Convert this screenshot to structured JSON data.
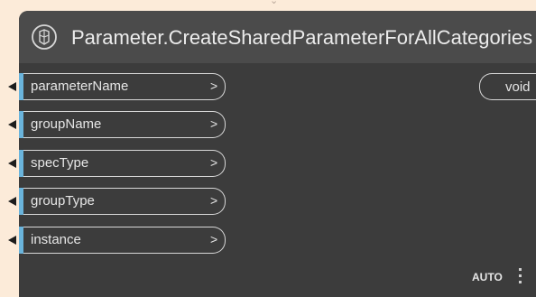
{
  "node": {
    "title": "Parameter.CreateSharedParameterForAllCategories",
    "icon": "revit-parameter-icon"
  },
  "inputs": [
    {
      "label": "parameterName",
      "arrow": ">"
    },
    {
      "label": "groupName",
      "arrow": ">"
    },
    {
      "label": "specType",
      "arrow": ">"
    },
    {
      "label": "groupType",
      "arrow": ">"
    },
    {
      "label": "instance",
      "arrow": ">"
    }
  ],
  "output": {
    "label": "void"
  },
  "footer": {
    "lacing": "AUTO"
  },
  "colors": {
    "background": "#fcebd9",
    "node_body": "#3c3c3c",
    "node_header": "#4b4b4b",
    "port_accent": "#6ab4dc",
    "text": "#e6e6e6"
  }
}
